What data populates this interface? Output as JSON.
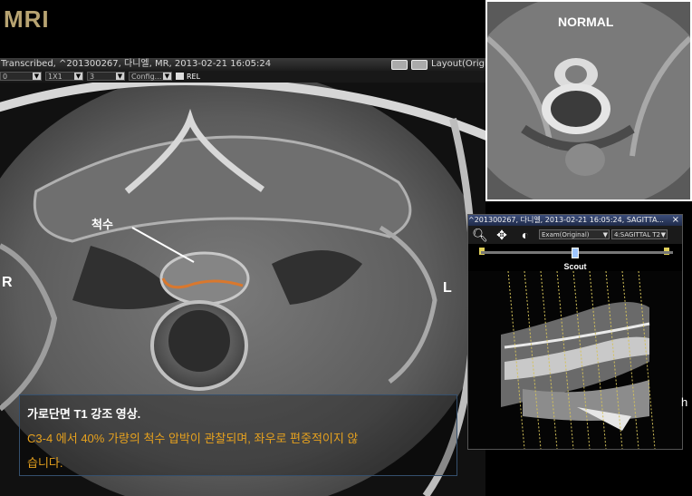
{
  "slide_title": "MRI",
  "viewer": {
    "info_bar": "Transcribed, ^201300267, 다니엘, MR, 2013-02-21 16:05:24",
    "layout_label": "Layout(Origin",
    "toolbar": {
      "sel1": "0",
      "sel2": "1X1",
      "sel3": "3",
      "sel4": "Config...",
      "rel_label": "REL"
    }
  },
  "image_labels": {
    "spinal_cord": "척수",
    "right": "R",
    "left": "L"
  },
  "normal_panel": {
    "label": "NORMAL"
  },
  "sagittal_window": {
    "title": "^201300267, 다니엘, 2013-02-21 16:05:24, SAGITTA...",
    "close": "×",
    "tools": {
      "zoom": "zoom-icon",
      "pan": "pan-icon",
      "contrast": "contrast-icon"
    },
    "exam_select": "Exam(Original)",
    "series_select": "4:SAGITTAL T2",
    "scout_label": "Scout"
  },
  "caption": {
    "line1": "가로단면 T1 강조 영상.",
    "line2": "C3-4 에서 40% 가량의 척수 압박이 관찰되며, 좌우로 편중적이지 않",
    "line3": "습니다."
  },
  "right_fragment": "h",
  "colors": {
    "title": "#b8a472",
    "caption_highlight": "#e6a11e",
    "annotation_curve": "#d9782e",
    "caption_border": "#35506e"
  }
}
